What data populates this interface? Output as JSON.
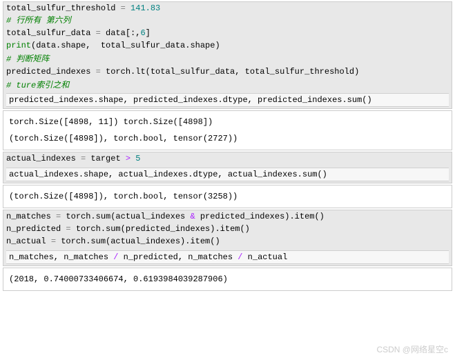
{
  "cell1": {
    "line1_var": "total_sulfur_threshold",
    "line1_eq": " = ",
    "line1_val": "141.83",
    "line2": "# 行所有 第六列",
    "line3_a": "total_sulfur_data ",
    "line3_eq": "=",
    "line3_b": " data[:,",
    "line3_num": "6",
    "line3_c": "]",
    "line4_print": "print",
    "line4_rest": "(data.shape,  total_sulfur_data.shape)",
    "line5": "",
    "line6": "# 判断矩阵",
    "line7_a": "predicted_indexes ",
    "line7_eq": "=",
    "line7_b": " torch.lt(total_sulfur_data, total_sulfur_threshold)",
    "line8": "",
    "line9": "# ture索引之和",
    "line10": "predicted_indexes.shape, predicted_indexes.dtype, predicted_indexes.sum()"
  },
  "output1": {
    "line1": "torch.Size([4898, 11]) torch.Size([4898])",
    "line2": "(torch.Size([4898]), torch.bool, tensor(2727))"
  },
  "cell2": {
    "line1_a": "actual_indexes ",
    "line1_eq": "=",
    "line1_b": " target ",
    "line1_op": ">",
    "line1_c": " ",
    "line1_num": "5",
    "line2": "",
    "line3": "actual_indexes.shape, actual_indexes.dtype, actual_indexes.sum()"
  },
  "output2": {
    "line1": "(torch.Size([4898]), torch.bool, tensor(3258))"
  },
  "cell3": {
    "line1_a": "n_matches ",
    "line1_eq": "=",
    "line1_b": " torch.sum(actual_indexes ",
    "line1_op": "&",
    "line1_c": " predicted_indexes).item()",
    "line2_a": "n_predicted ",
    "line2_eq": "=",
    "line2_b": " torch.sum(predicted_indexes).item()",
    "line3_a": "n_actual ",
    "line3_eq": "=",
    "line3_b": " torch.sum(actual_indexes).item()",
    "line4": "",
    "line5_a": "n_matches, n_matches ",
    "line5_op1": "/",
    "line5_b": " n_predicted, n_matches ",
    "line5_op2": "/",
    "line5_c": " n_actual"
  },
  "output3": {
    "line1": "(2018, 0.74000733406674, 0.6193984039287906)"
  },
  "watermark": "CSDN @网络星空c"
}
